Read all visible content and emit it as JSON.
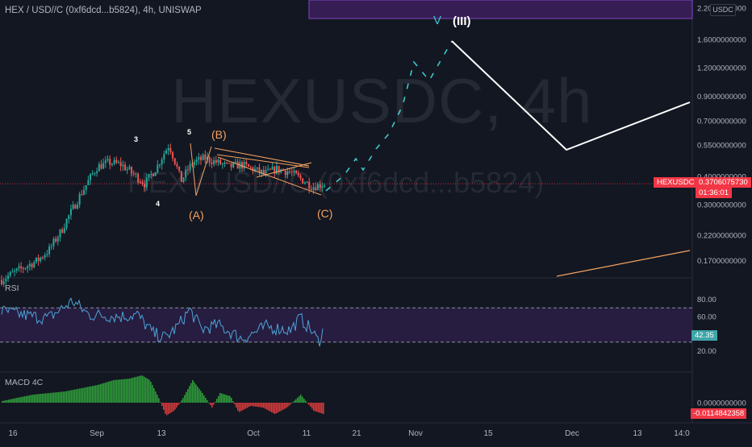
{
  "header": {
    "symbol": "HEX / USD//C (0xf6dcd...b5824)",
    "interval": "4h",
    "exchange": "UNISWAP"
  },
  "watermark": {
    "big": "HEXUSDC, 4h",
    "small": "HEX / USD//C (0xf6dcd...b5824)"
  },
  "price_scale": {
    "currency_button": "USDC",
    "labels": [
      "2.2000000000",
      "1.6000000000",
      "1.2000000000",
      "0.9000000000",
      "0.7000000000",
      "0.5500000000",
      "0.4000000000",
      "0.3000000000",
      "0.2200000000",
      "0.1700000000"
    ],
    "current_label": "HEXUSDC",
    "current_price": "0.3706075730",
    "countdown": "01:36:01"
  },
  "rsi": {
    "label": "RSI",
    "scale": [
      "80.00",
      "60.00",
      "40.00",
      "20.00"
    ],
    "value": "42.35",
    "upper_band": 70,
    "lower_band": 30
  },
  "macd": {
    "label": "MACD 4C",
    "scale": [
      "0.0000000000"
    ],
    "value": "-0.0114842358"
  },
  "time_axis": [
    "16",
    "Sep",
    "13",
    "Oct",
    "11",
    "21",
    "Nov",
    "15",
    "Dec",
    "13",
    "14:0"
  ],
  "wave_labels": {
    "w3": "3",
    "w4": "4",
    "w5": "5",
    "wA": "(A)",
    "wB": "(B)",
    "wC": "(C)",
    "wV": "V",
    "wIII": "(III)"
  },
  "colors": {
    "background": "#131722",
    "candle_up": "#26a69a",
    "candle_down": "#ef5350",
    "rsi_line": "#4fa3d8",
    "rsi_band": "#2a1f45",
    "projection": "#ffffff",
    "wave_orange": "#f4a261",
    "wave_teal": "#3ec6c6",
    "price_tag": "#f23645",
    "rsi_tag": "#3fa5a8",
    "zone": "#3a1f5a"
  },
  "chart_data": [
    {
      "type": "candlestick",
      "title": "HEX / USD//C (0xf6dcd...b5824), 4h, UNISWAP",
      "scale": "log",
      "ylim": [
        0.11,
        2.6
      ],
      "x": [
        "16",
        "Sep",
        "13",
        "Oct",
        "11"
      ],
      "close_path": [
        0.14,
        0.15,
        0.16,
        0.17,
        0.19,
        0.23,
        0.29,
        0.36,
        0.44,
        0.46,
        0.45,
        0.41,
        0.37,
        0.44,
        0.55,
        0.38,
        0.46,
        0.48,
        0.46,
        0.44,
        0.45,
        0.43,
        0.41,
        0.43,
        0.42,
        0.39,
        0.36,
        0.37
      ],
      "last": 0.370607573
    },
    {
      "type": "line",
      "title": "RSI",
      "ylim": [
        0,
        100
      ],
      "bands": [
        30,
        70
      ],
      "last": 42.35
    },
    {
      "type": "bar",
      "title": "MACD 4C",
      "last": -0.0114842358
    }
  ]
}
